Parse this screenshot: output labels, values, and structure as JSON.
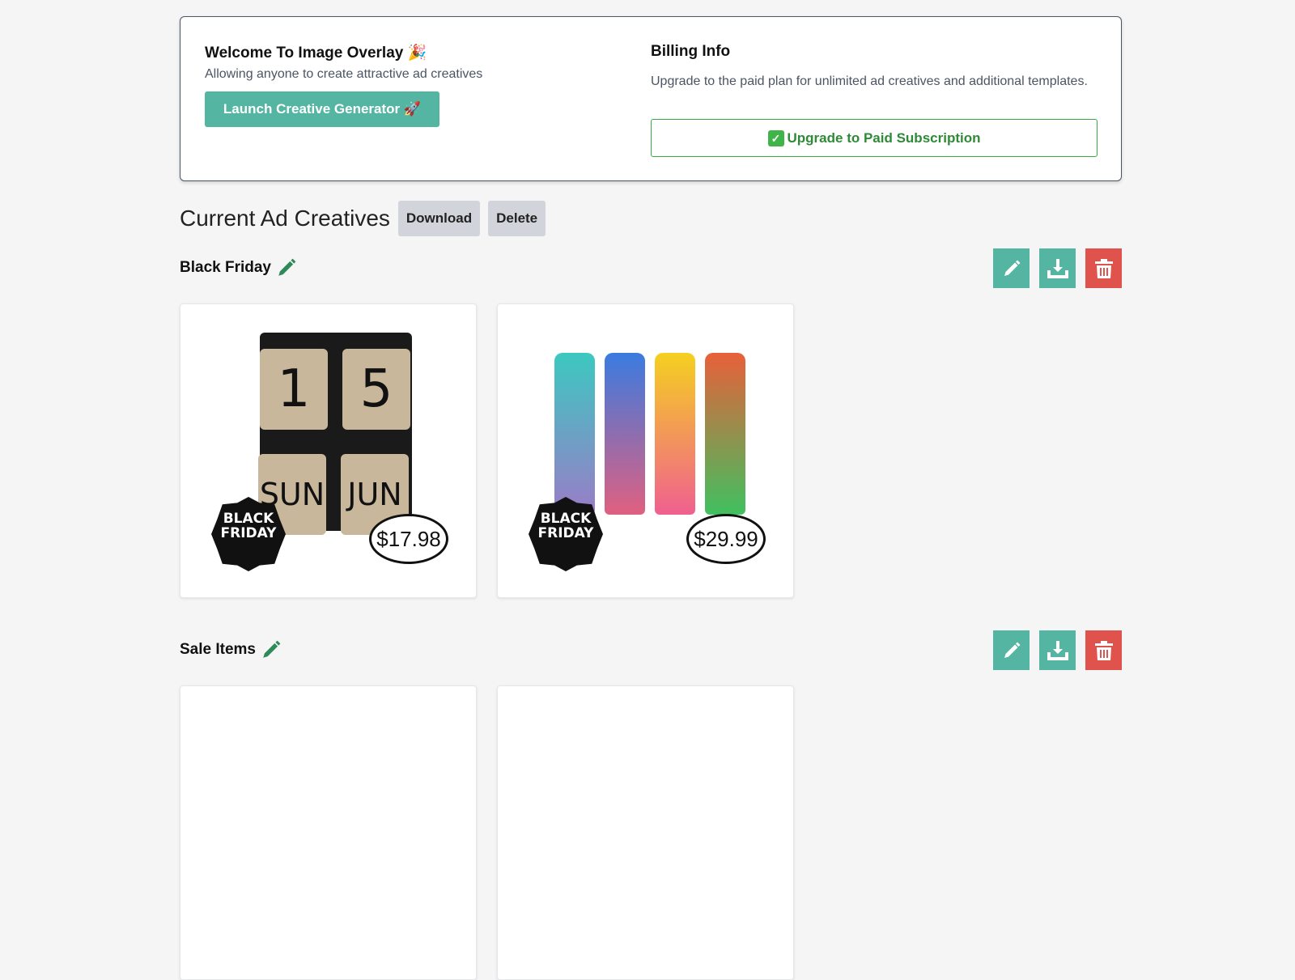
{
  "welcome": {
    "title": "Welcome To Image Overlay 🎉",
    "subtitle": "Allowing anyone to create attractive ad creatives",
    "launch_label": "Launch Creative Generator 🚀"
  },
  "billing": {
    "title": "Billing Info",
    "description": "Upgrade to the paid plan for unlimited ad creatives and additional templates.",
    "upgrade_label": "Upgrade to Paid Subscription",
    "upgrade_icon": "check-mark-button"
  },
  "creatives": {
    "title": "Current Ad Creatives",
    "download_label": "Download",
    "delete_label": "Delete"
  },
  "colors": {
    "teal": "#55b5a3",
    "red": "#e0524c",
    "green": "#3aa845"
  },
  "groups": [
    {
      "name": "Black Friday",
      "items": [
        {
          "badge": "BLACK FRIDAY",
          "price": "$17.98",
          "tiles": [
            "1",
            "5",
            "SUN",
            "JUN"
          ]
        },
        {
          "badge": "BLACK FRIDAY",
          "price": "$29.99"
        }
      ]
    },
    {
      "name": "Sale Items"
    }
  ]
}
